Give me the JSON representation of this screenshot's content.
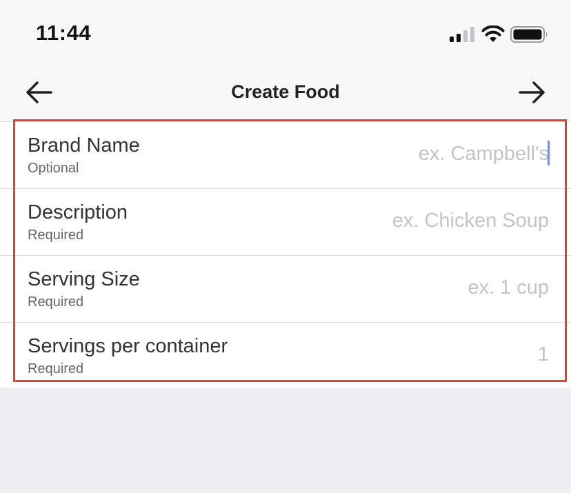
{
  "status_bar": {
    "time": "11:44",
    "icons": [
      "cellular-signal-icon",
      "wifi-icon",
      "battery-icon"
    ]
  },
  "nav": {
    "title": "Create Food",
    "back_icon": "arrow-left-icon",
    "forward_icon": "arrow-right-icon"
  },
  "form": {
    "rows": [
      {
        "label": "Brand Name",
        "sublabel": "Optional",
        "placeholder": "ex. Campbell's",
        "value": ""
      },
      {
        "label": "Description",
        "sublabel": "Required",
        "placeholder": "ex. Chicken Soup",
        "value": ""
      },
      {
        "label": "Serving Size",
        "sublabel": "Required",
        "placeholder": "ex. 1 cup",
        "value": ""
      },
      {
        "label": "Servings per container",
        "sublabel": "Required",
        "placeholder": "1",
        "value": ""
      }
    ]
  },
  "colors": {
    "highlight_border": "#e2432f",
    "caret": "#7a8fe0",
    "background": "#efeff4",
    "placeholder": "#c4c4c6"
  }
}
